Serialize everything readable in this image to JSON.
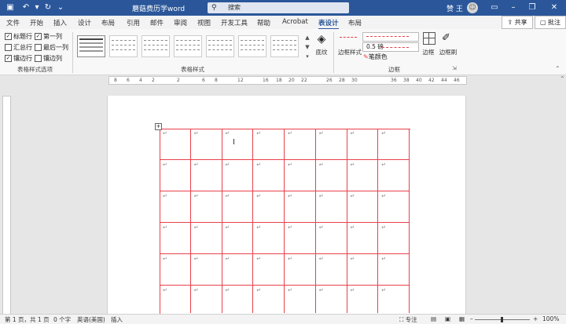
{
  "titlebar": {
    "doc_title": "蘑菇费历学word",
    "search_placeholder": "搜索",
    "user_name": "赞 王",
    "avatar_glyph": "☺",
    "icons": [
      "save-icon",
      "undo-icon",
      "redo-icon",
      "customize-icon"
    ]
  },
  "tabs": [
    "文件",
    "开始",
    "插入",
    "设计",
    "布局",
    "引用",
    "邮件",
    "审阅",
    "视图",
    "开发工具",
    "帮助",
    "Acrobat",
    "表设计",
    "布局"
  ],
  "active_tab": "表设计",
  "share_label": "共享",
  "comment_label": "批注",
  "ribbon": {
    "style_options": {
      "header_row": "标题行",
      "first_col": "第一列",
      "total_row": "汇总行",
      "last_col": "最后一列",
      "banded_rows": "镶边行",
      "banded_cols": "镶边列",
      "group_label": "表格样式选项"
    },
    "table_styles_label": "表格样式",
    "shading_label": "底纹",
    "border_styles_label": "边框样式",
    "pen_weight": "0.5 磅",
    "pen_color_label": "笔颜色",
    "borders_label": "边框",
    "border_painter_label": "边框刷",
    "borders_group_label": "边框",
    "accent_color": "#2b579a",
    "pen_color": "#e8404a"
  },
  "ruler_numbers": [
    "8",
    "6",
    "4",
    "2",
    "",
    "2",
    "",
    "6",
    "8",
    "",
    "12",
    "",
    "16",
    "18",
    "20",
    "22",
    "",
    "26",
    "28",
    "30",
    "",
    "36",
    "38",
    "40",
    "42",
    "44",
    "46"
  ],
  "table": {
    "rows": 6,
    "cols": 8,
    "cell_mark": "↵"
  },
  "status": {
    "page": "第 1 页，共 1 页",
    "words": "0 个字",
    "language": "英语(美国)",
    "mode": "插入",
    "focus": "专注",
    "zoom": "100%"
  }
}
